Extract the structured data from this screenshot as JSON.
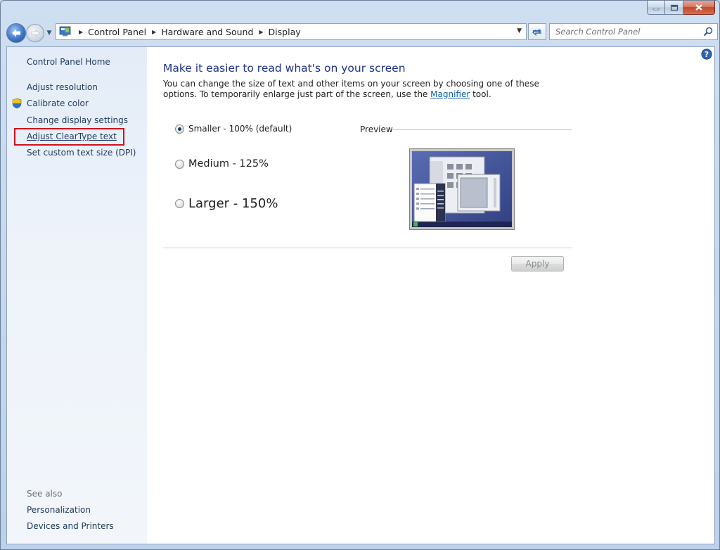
{
  "window": {
    "caption_buttons": [
      "minimize-icon",
      "maximize-icon",
      "close-icon"
    ]
  },
  "navigation": {
    "breadcrumb": [
      "Control Panel",
      "Hardware and Sound",
      "Display"
    ],
    "search_placeholder": "Search Control Panel"
  },
  "sidebar": {
    "home": "Control Panel Home",
    "links": [
      {
        "label": "Adjust resolution",
        "icon": null
      },
      {
        "label": "Calibrate color",
        "icon": "shield-icon"
      },
      {
        "label": "Change display settings",
        "icon": null
      },
      {
        "label": "Adjust ClearType text",
        "icon": null,
        "highlighted": true
      },
      {
        "label": "Set custom text size (DPI)",
        "icon": null
      }
    ],
    "see_also_title": "See also",
    "see_also": [
      "Personalization",
      "Devices and Printers"
    ]
  },
  "main": {
    "heading": "Make it easier to read what's on your screen",
    "description_before": "You can change the size of text and other items on your screen by choosing one of these options. To temporarily enlarge just part of the screen, use the ",
    "description_link": "Magnifier",
    "description_after": " tool.",
    "options": [
      {
        "label": "Smaller - 100% (default)",
        "selected": true
      },
      {
        "label": "Medium - 125%",
        "selected": false
      },
      {
        "label": "Larger - 150%",
        "selected": false
      }
    ],
    "preview_label": "Preview",
    "apply_label": "Apply",
    "apply_enabled": false
  },
  "colors": {
    "heading": "#1e3287",
    "link": "#0f5fa8",
    "highlight_box": "#d0111a"
  }
}
